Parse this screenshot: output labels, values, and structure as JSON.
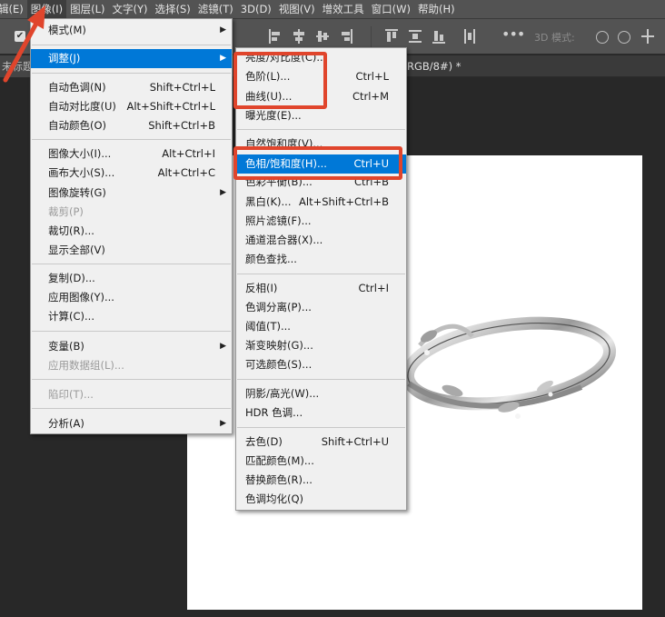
{
  "menubar": {
    "items": [
      {
        "label": "辑(E)"
      },
      {
        "label": "图像(I)"
      },
      {
        "label": "图层(L)"
      },
      {
        "label": "文字(Y)"
      },
      {
        "label": "选择(S)"
      },
      {
        "label": "滤镜(T)"
      },
      {
        "label": "3D(D)"
      },
      {
        "label": "视图(V)"
      },
      {
        "label": "增效工具"
      },
      {
        "label": "窗口(W)"
      },
      {
        "label": "帮助(H)"
      }
    ],
    "active": "图像(I)"
  },
  "options_bar": {
    "mode_3d_label": "3D 模式:"
  },
  "tabs": {
    "left_label": "未标题",
    "doc_label": "RGB/8#) *"
  },
  "image_menu": {
    "items": [
      {
        "label": "模式(M)",
        "shortcut": "",
        "submenu": true
      },
      {
        "label": "调整(J)",
        "shortcut": "",
        "submenu": true,
        "highlighted": true
      },
      {
        "label": "自动色调(N)",
        "shortcut": "Shift+Ctrl+L"
      },
      {
        "label": "自动对比度(U)",
        "shortcut": "Alt+Shift+Ctrl+L"
      },
      {
        "label": "自动颜色(O)",
        "shortcut": "Shift+Ctrl+B"
      },
      {
        "label": "图像大小(I)...",
        "shortcut": "Alt+Ctrl+I"
      },
      {
        "label": "画布大小(S)...",
        "shortcut": "Alt+Ctrl+C"
      },
      {
        "label": "图像旋转(G)",
        "shortcut": "",
        "submenu": true
      },
      {
        "label": "裁剪(P)",
        "shortcut": "",
        "disabled": true
      },
      {
        "label": "裁切(R)...",
        "shortcut": ""
      },
      {
        "label": "显示全部(V)",
        "shortcut": ""
      },
      {
        "label": "复制(D)...",
        "shortcut": ""
      },
      {
        "label": "应用图像(Y)...",
        "shortcut": ""
      },
      {
        "label": "计算(C)...",
        "shortcut": ""
      },
      {
        "label": "变量(B)",
        "shortcut": "",
        "submenu": true
      },
      {
        "label": "应用数据组(L)...",
        "shortcut": "",
        "disabled": true
      },
      {
        "label": "陷印(T)...",
        "shortcut": "",
        "disabled": true
      },
      {
        "label": "分析(A)",
        "shortcut": "",
        "submenu": true
      }
    ]
  },
  "adjust_menu": {
    "items": [
      {
        "label": "亮度/对比度(C)...",
        "shortcut": ""
      },
      {
        "label": "色阶(L)...",
        "shortcut": "Ctrl+L"
      },
      {
        "label": "曲线(U)...",
        "shortcut": "Ctrl+M"
      },
      {
        "label": "曝光度(E)...",
        "shortcut": ""
      },
      {
        "label": "自然饱和度(V)...",
        "shortcut": ""
      },
      {
        "label": "色相/饱和度(H)...",
        "shortcut": "Ctrl+U",
        "highlighted": true
      },
      {
        "label": "色彩平衡(B)...",
        "shortcut": "Ctrl+B"
      },
      {
        "label": "黑白(K)...",
        "shortcut": "Alt+Shift+Ctrl+B"
      },
      {
        "label": "照片滤镜(F)...",
        "shortcut": ""
      },
      {
        "label": "通道混合器(X)...",
        "shortcut": ""
      },
      {
        "label": "颜色查找...",
        "shortcut": ""
      },
      {
        "label": "反相(I)",
        "shortcut": "Ctrl+I"
      },
      {
        "label": "色调分离(P)...",
        "shortcut": ""
      },
      {
        "label": "阈值(T)...",
        "shortcut": ""
      },
      {
        "label": "渐变映射(G)...",
        "shortcut": ""
      },
      {
        "label": "可选颜色(S)...",
        "shortcut": ""
      },
      {
        "label": "阴影/高光(W)...",
        "shortcut": ""
      },
      {
        "label": "HDR 色调...",
        "shortcut": ""
      },
      {
        "label": "去色(D)",
        "shortcut": "Shift+Ctrl+U"
      },
      {
        "label": "匹配颜色(M)...",
        "shortcut": ""
      },
      {
        "label": "替换颜色(R)...",
        "shortcut": ""
      },
      {
        "label": "色调均化(Q)",
        "shortcut": ""
      }
    ]
  },
  "colors": {
    "highlight": "#0078d7",
    "annotation": "#e0452c"
  }
}
